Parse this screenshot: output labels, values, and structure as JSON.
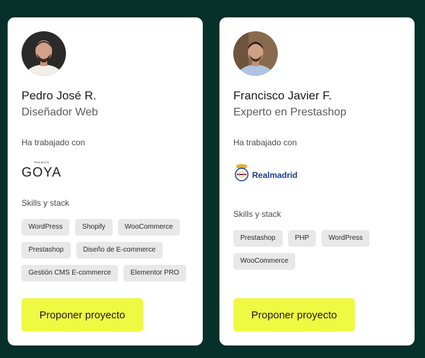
{
  "freelancers": [
    {
      "name": "Pedro José R.",
      "role": "Diseñador Web",
      "worked_with_label": "Ha trabajado con",
      "client_logo": {
        "icon": "premios-goya-logo",
        "small_text": "PREMIOS",
        "big_text": "GOYA"
      },
      "skills_label": "Skills y stack",
      "skills": [
        "WordPress",
        "Shopify",
        "WooCommerce",
        "Prestashop",
        "Diseño de E-commerce",
        "Gestión CMS E-commerce",
        "Elementor PRO"
      ],
      "cta_label": "Proponer proyecto"
    },
    {
      "name": "Francisco Javier F.",
      "role": "Experto en Prestashop",
      "worked_with_label": "Ha trabajado con",
      "client_logo": {
        "icon": "real-madrid-logo",
        "text_a": "Real",
        "text_b": "madrid"
      },
      "skills_label": "Skills y stack",
      "skills": [
        "Prestashop",
        "PHP",
        "WordPress",
        "WooCommerce"
      ],
      "cta_label": "Proponer proyecto"
    }
  ],
  "colors": {
    "background": "#06302a",
    "card": "#ffffff",
    "cta": "#eef942",
    "chip": "#e8e8e8",
    "real_madrid_blue": "#1a3d8f"
  }
}
